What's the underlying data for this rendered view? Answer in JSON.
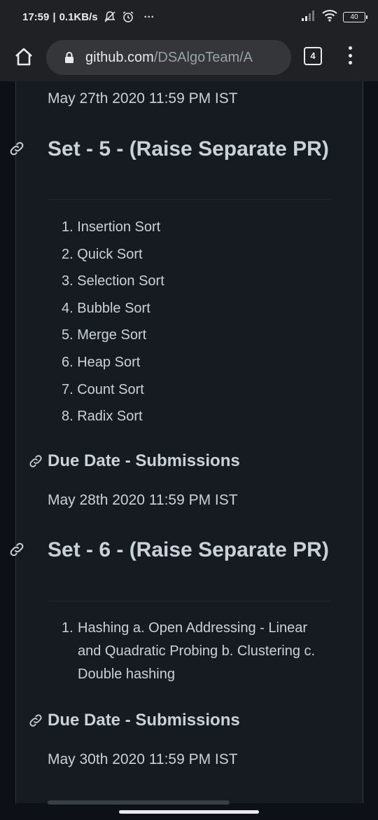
{
  "status_bar": {
    "time": "17:59",
    "network_speed": "0.1KB/s",
    "more": "···",
    "battery": "40"
  },
  "browser": {
    "url_host": "github.com",
    "url_path": "/DSAlgoTeam/A",
    "tab_count": "4"
  },
  "content": {
    "top_date": "May 27th 2020 11:59 PM IST",
    "set5": {
      "heading": "Set - 5 - (Raise Separate PR)",
      "items": [
        "1. Insertion Sort",
        "2. Quick Sort",
        "3. Selection Sort",
        "4. Bubble Sort",
        "5. Merge Sort",
        "6. Heap Sort",
        "7. Count Sort",
        "8. Radix Sort"
      ]
    },
    "due1": {
      "heading": "Due Date - Submissions",
      "date": "May 28th 2020 11:59 PM IST"
    },
    "set6": {
      "heading": "Set - 6 - (Raise Separate PR)",
      "item_number": "1.",
      "item_text": "Hashing a. Open Addressing - Linear and Quadratic Probing b. Clustering c. Double hashing"
    },
    "due2": {
      "heading": "Due Date - Submissions",
      "date": "May 30th 2020 11:59 PM IST"
    }
  },
  "icons": {
    "link": "link-icon",
    "home": "home-icon",
    "lock": "lock-icon",
    "menu": "more-vert-icon"
  }
}
